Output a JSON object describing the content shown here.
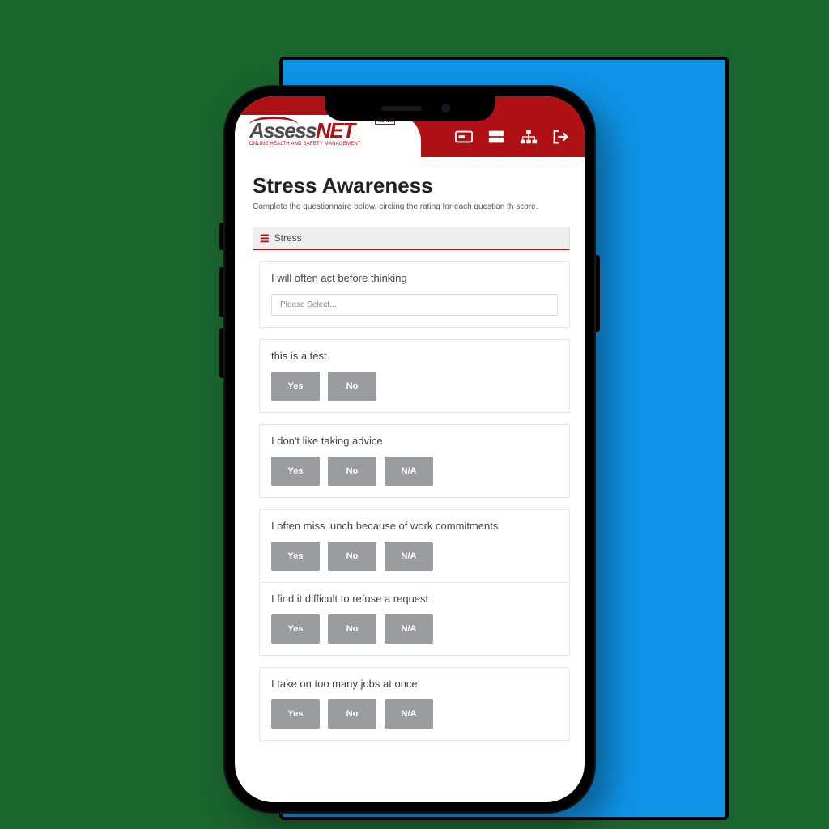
{
  "brand": {
    "name_part1": "Assess",
    "name_part2": "NET",
    "badge": "RISKEX",
    "tagline": "ONLINE HEALTH AND SAFETY MANAGEMENT"
  },
  "header_icons": [
    "card-icon",
    "stack-icon",
    "sitemap-icon",
    "logout-icon"
  ],
  "page": {
    "title": "Stress Awareness",
    "subtitle": "Complete the questionnaire below, circling the rating for each question th score."
  },
  "section": {
    "label": "Stress"
  },
  "select_placeholder": "Please Select...",
  "option_labels": {
    "yes": "Yes",
    "no": "No",
    "na": "N/A"
  },
  "questions": [
    {
      "text": "I will often act before thinking",
      "type": "select"
    },
    {
      "text": "this is a test",
      "type": "yn"
    },
    {
      "text": "I don't like taking advice",
      "type": "ynna"
    },
    {
      "text": "I often miss lunch because of work commitments",
      "type": "ynna"
    },
    {
      "text": "I find it difficult to refuse a request",
      "type": "ynna"
    },
    {
      "text": "I take on too many jobs at once",
      "type": "ynna"
    }
  ],
  "colors": {
    "brand_red": "#b01116",
    "bg_green": "#1a642e",
    "accent_blue": "#0f94e8",
    "button_gray": "#9a9d9f"
  }
}
